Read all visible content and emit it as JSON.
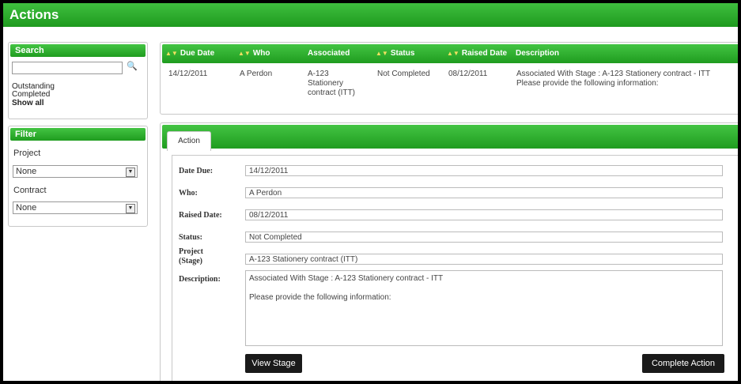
{
  "window": {
    "title": "Actions"
  },
  "search": {
    "header": "Search",
    "input_value": "",
    "icon": "magnifier-icon",
    "links": [
      "Outstanding",
      "Completed",
      "Show all"
    ]
  },
  "filter": {
    "header": "Filter",
    "project_label": "Project",
    "project_value": "None",
    "contract_label": "Contract",
    "contract_value": "None"
  },
  "grid": {
    "columns": [
      "Due Date",
      "Who",
      "Associated",
      "Status",
      "Raised Date",
      "Description"
    ],
    "rows": [
      {
        "due_date": "14/12/2011",
        "who": "A Perdon",
        "associated": [
          "A-123",
          "Stationery",
          "contract (ITT)"
        ],
        "status": "Not Completed",
        "raised_date": "08/12/2011",
        "description": [
          "Associated With Stage : A-123 Stationery contract - ITT",
          "Please provide the following information:"
        ]
      }
    ]
  },
  "detail": {
    "tab": "Action",
    "fields": {
      "date_due_label": "Date Due:",
      "date_due": "14/12/2011",
      "who_label": "Who:",
      "who": "A Perdon",
      "raised_label": "Raised Date:",
      "raised": "08/12/2011",
      "status_label": "Status:",
      "status": "Not Completed",
      "project_label_1": "Project",
      "project_label_2": "(Stage)",
      "project": "A-123 Stationery contract (ITT)",
      "description_label": "Description:",
      "description_1": "Associated With Stage : A-123 Stationery contract - ITT",
      "description_2": "Please provide the following information:"
    },
    "buttons": {
      "view_stage": "View Stage",
      "complete_action": "Complete Action"
    }
  },
  "colors": {
    "header_green": "#2aa82a",
    "button_dark": "#1a1a1a"
  }
}
